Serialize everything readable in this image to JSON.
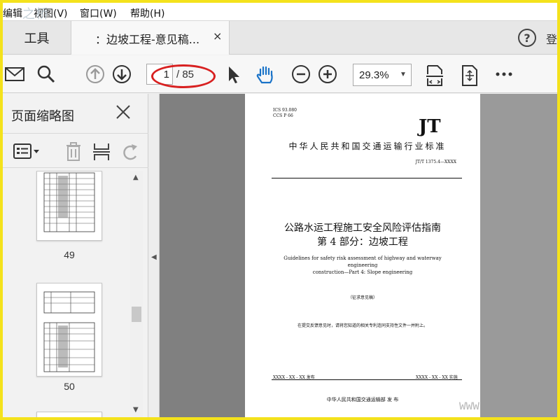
{
  "menu": {
    "items": [
      "编辑",
      "视图(V)",
      "窗口(W)",
      "帮助(H)"
    ]
  },
  "watermark_top": "之桥",
  "tabs": {
    "tools": "工具",
    "document": "：边坡工程-意见稿...",
    "close": "×",
    "signin_partial": "登"
  },
  "toolbar": {
    "current_page": "1",
    "page_total": "/ 85",
    "zoom": "29.3%",
    "icons": [
      "mail-icon",
      "search-icon",
      "arrow-up-icon",
      "arrow-down-icon",
      "select-cursor-icon",
      "hand-icon",
      "zoom-out-icon",
      "zoom-in-icon",
      "fit-width-icon",
      "fit-page-icon",
      "more-icon"
    ]
  },
  "panel": {
    "title": "页面缩略图",
    "thumbnails": [
      {
        "label": "49"
      },
      {
        "label": "50"
      }
    ]
  },
  "document": {
    "ics": "ICS  93.080",
    "ccs": "CCS  P 66",
    "logo": "JT",
    "std_title": "中华人民共和国交通运输行业标准",
    "std_number": "JT/T 1375.4—XXXX",
    "title_line1": "公路水运工程施工安全风险评估指南",
    "title_line2": "第 4 部分：边坡工程",
    "en_line1": "Guidelines for safety risk assessment of highway and waterway engineering",
    "en_line2": "construction—Part 4: Slope engineering",
    "draft": "（征求意见稿）",
    "notice": "在提交反馈意见时，请将您知道的相关专利连同支持性文件一并附上。",
    "issue_date": "XXXX - XX - XX 发布",
    "impl_date": "XXXX - XX - XX 实施",
    "issuer": "中华人民共和国交通运输部    发 布"
  },
  "watermark_bottom": "WWW",
  "colors": {
    "border": "#f4e21c",
    "annotation": "#d82020",
    "workspace": "#808080"
  }
}
